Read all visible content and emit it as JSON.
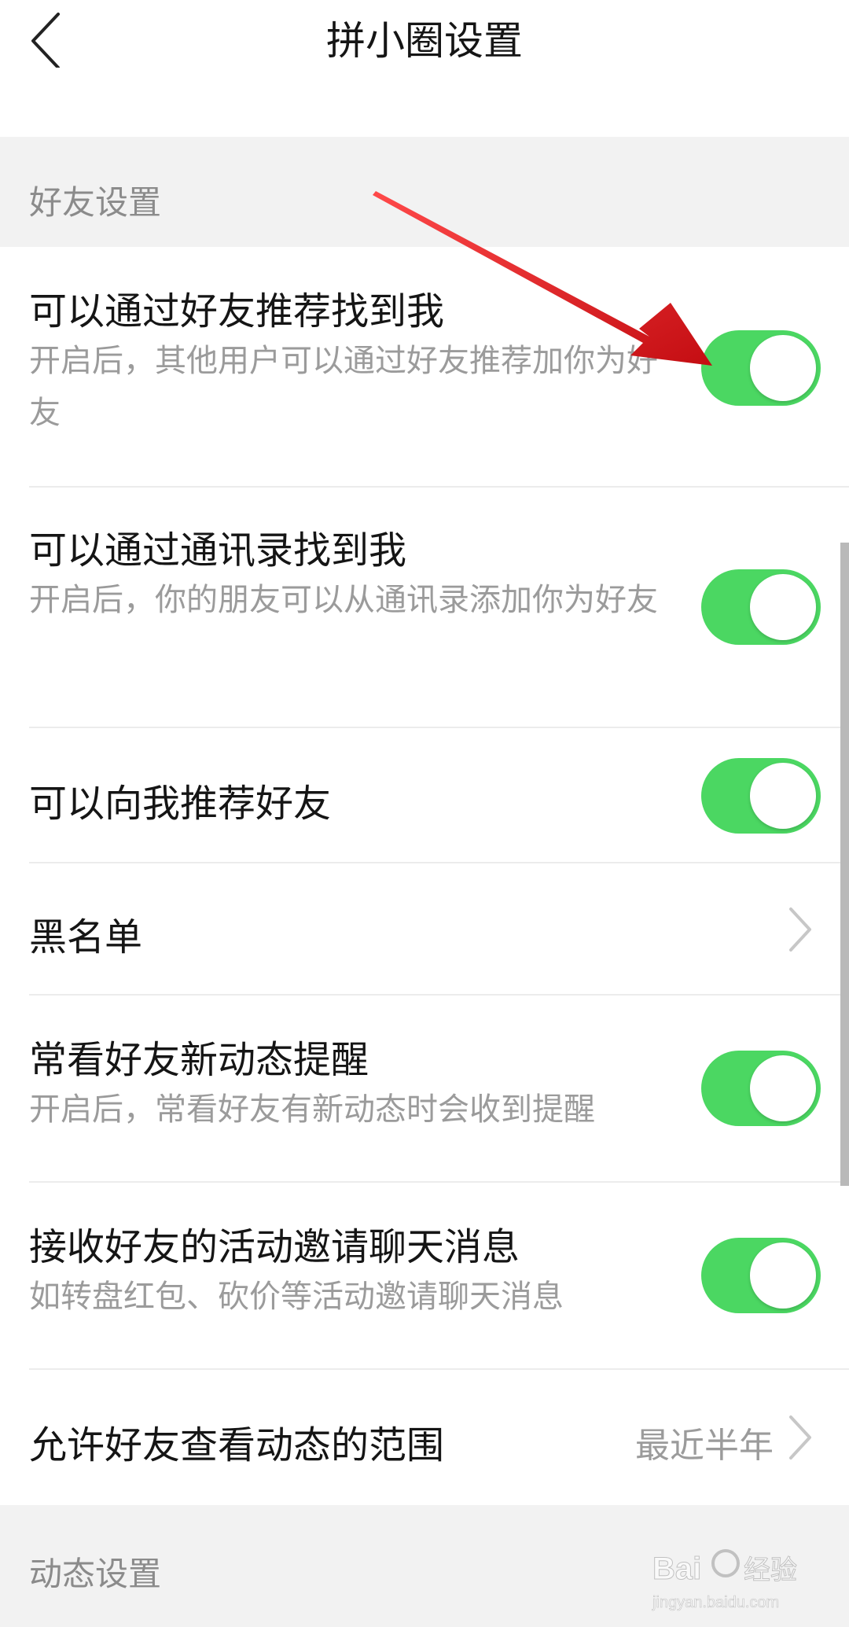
{
  "header": {
    "title": "拼小圈设置",
    "back_icon": "back-arrow-icon"
  },
  "sections": {
    "friends": {
      "label": "好友设置"
    },
    "dynamics": {
      "label": "动态设置"
    }
  },
  "rows": {
    "recommend_find_me": {
      "label": "可以通过好友推荐找到我",
      "desc": "开启后，其他用户可以通过好友推荐加你为好友",
      "on": true
    },
    "contacts_find_me": {
      "label": "可以通过通讯录找到我",
      "desc": "开启后，你的朋友可以从通讯录添加你为好友",
      "on": true
    },
    "recommend_friends": {
      "label": "可以向我推荐好友",
      "on": true
    },
    "blacklist": {
      "label": "黑名单"
    },
    "frequent_updates": {
      "label": "常看好友新动态提醒",
      "desc": "开启后，常看好友有新动态时会收到提醒",
      "on": true
    },
    "activity_invites": {
      "label": "接收好友的活动邀请聊天消息",
      "desc": "如转盘红包、砍价等活动邀请聊天消息",
      "on": true
    },
    "visibility_range": {
      "label": "允许好友查看动态的范围",
      "value": "最近半年"
    }
  },
  "colors": {
    "toggle_on": "#4bd762",
    "section_bg": "#f2f2f2",
    "annotation_arrow": "#e8151b"
  },
  "watermark": {
    "text": "Bai 经验",
    "url": "jingyan.baidu.com"
  }
}
